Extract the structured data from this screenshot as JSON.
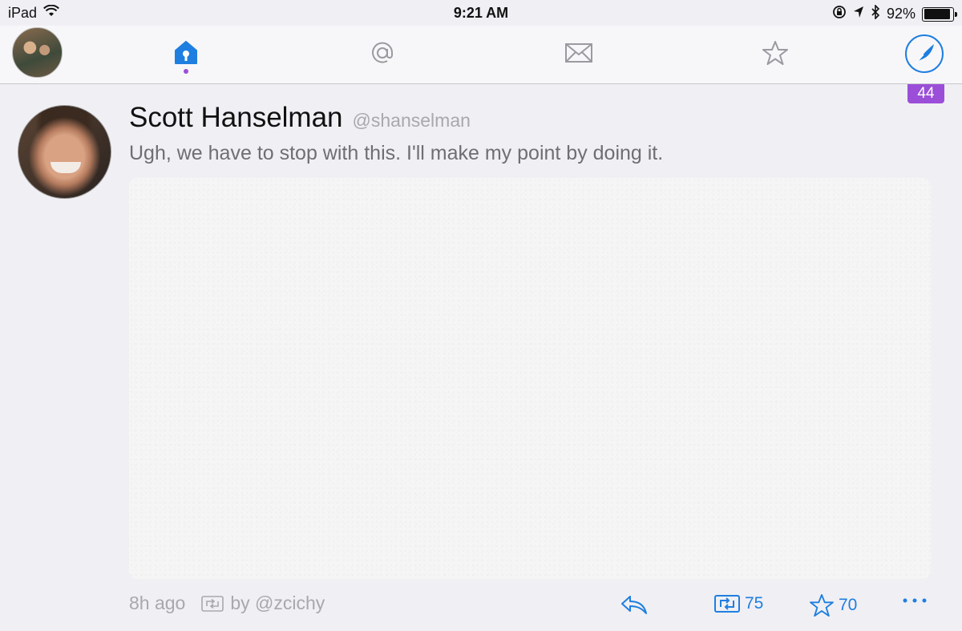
{
  "status_bar": {
    "device": "iPad",
    "time": "9:21 AM",
    "battery": "92%",
    "battery_level": 0.92
  },
  "tabs": [
    {
      "name": "home",
      "icon": "home-icon",
      "selected": true
    },
    {
      "name": "mentions",
      "icon": "at-icon",
      "selected": false
    },
    {
      "name": "messages",
      "icon": "mail-icon",
      "selected": false
    },
    {
      "name": "favorites",
      "icon": "star-icon",
      "selected": false
    }
  ],
  "compose_icon": "quill-icon",
  "unread_badge": "44",
  "colors": {
    "accent": "#1e7fe0",
    "badge": "#9b4fd9",
    "background": "#efeff4"
  },
  "tweet": {
    "author_name": "Scott Hanselman",
    "author_handle": "@shanselman",
    "text": "Ugh, we have to stop with this. I'll make my point by doing it.",
    "time_ago": "8h ago",
    "retweeted_by": "by @zcichy",
    "retweet_count": "75",
    "favorite_count": "70"
  }
}
